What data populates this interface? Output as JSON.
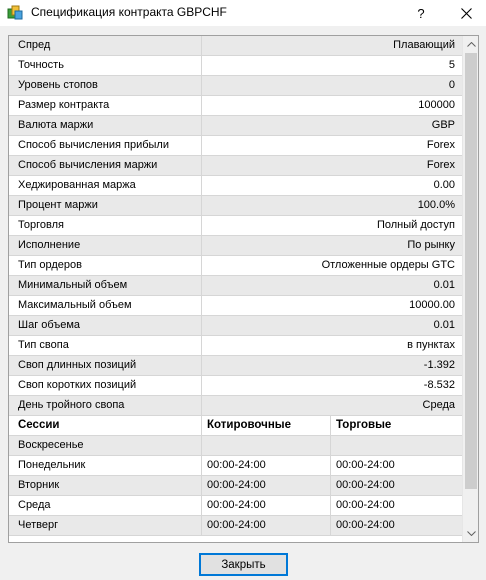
{
  "window": {
    "title": "Спецификация контракта GBPCHF",
    "help_label": "?",
    "app_icon": "app-icon",
    "close_icon": "close-icon"
  },
  "properties": [
    {
      "name": "Спред",
      "value": "Плавающий"
    },
    {
      "name": "Точность",
      "value": "5"
    },
    {
      "name": "Уровень стопов",
      "value": "0"
    },
    {
      "name": "Размер контракта",
      "value": "100000"
    },
    {
      "name": "Валюта маржи",
      "value": "GBP"
    },
    {
      "name": "Способ вычисления прибыли",
      "value": "Forex"
    },
    {
      "name": "Способ вычисления маржи",
      "value": "Forex"
    },
    {
      "name": "Хеджированная маржа",
      "value": "0.00"
    },
    {
      "name": "Процент маржи",
      "value": "100.0%"
    },
    {
      "name": "Торговля",
      "value": "Полный доступ"
    },
    {
      "name": "Исполнение",
      "value": "По рынку"
    },
    {
      "name": "Тип ордеров",
      "value": "Отложенные ордеры GTC"
    },
    {
      "name": "Минимальный объем",
      "value": "0.01"
    },
    {
      "name": "Максимальный объем",
      "value": "10000.00"
    },
    {
      "name": "Шаг объема",
      "value": "0.01"
    },
    {
      "name": "Тип свопа",
      "value": "в пунктах"
    },
    {
      "name": "Своп длинных позиций",
      "value": "-1.392"
    },
    {
      "name": "Своп коротких позиций",
      "value": "-8.532"
    },
    {
      "name": "День тройного свопа",
      "value": "Среда"
    }
  ],
  "sessions": {
    "headers": [
      "Сессии",
      "Котировочные",
      "Торговые"
    ],
    "rows": [
      {
        "day": "Воскресенье",
        "quote": "",
        "trade": ""
      },
      {
        "day": "Понедельник",
        "quote": "00:00-24:00",
        "trade": "00:00-24:00"
      },
      {
        "day": "Вторник",
        "quote": "00:00-24:00",
        "trade": "00:00-24:00"
      },
      {
        "day": "Среда",
        "quote": "00:00-24:00",
        "trade": "00:00-24:00"
      },
      {
        "day": "Четверг",
        "quote": "00:00-24:00",
        "trade": "00:00-24:00"
      }
    ]
  },
  "footer": {
    "close_label": "Закрыть"
  },
  "colors": {
    "row_alt": "#e9e9e9",
    "button_focus": "#0078d7"
  }
}
